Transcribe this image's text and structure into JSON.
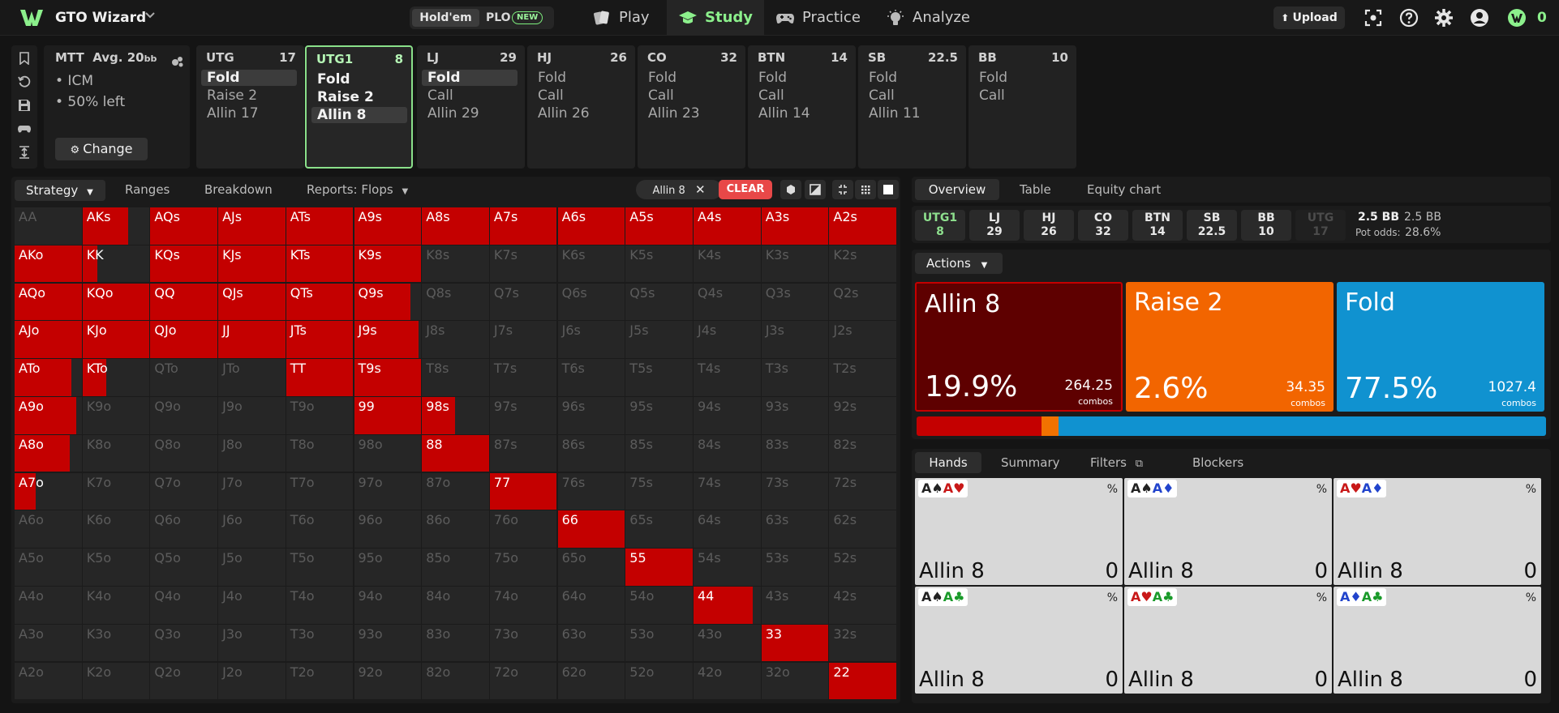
{
  "app": {
    "title": "GTO Wizard"
  },
  "game_switch": {
    "holdem": "Hold'em",
    "plo": "PLO",
    "new_badge": "NEW"
  },
  "nav": {
    "play": "Play",
    "study": "Study",
    "practice": "Practice",
    "analyze": "Analyze"
  },
  "toolbar": {
    "upload": "Upload",
    "balance": "0"
  },
  "mtt": {
    "title": "MTT",
    "avg": "Avg. 20",
    "bb": "bb",
    "line1": "• ICM",
    "line2": "• 50% left",
    "change": "Change"
  },
  "positions": [
    {
      "name": "UTG",
      "stack": "17",
      "actions": [
        "Fold",
        "Raise 2",
        "Allin 17"
      ]
    },
    {
      "name": "UTG1",
      "stack": "8",
      "actions": [
        "Fold",
        "Raise 2",
        "Allin 8"
      ]
    },
    {
      "name": "LJ",
      "stack": "29",
      "actions": [
        "Fold",
        "Call",
        "Allin 29"
      ]
    },
    {
      "name": "HJ",
      "stack": "26",
      "actions": [
        "Fold",
        "Call",
        "Allin 26"
      ]
    },
    {
      "name": "CO",
      "stack": "32",
      "actions": [
        "Fold",
        "Call",
        "Allin 23"
      ]
    },
    {
      "name": "BTN",
      "stack": "14",
      "actions": [
        "Fold",
        "Call",
        "Allin 14"
      ]
    },
    {
      "name": "SB",
      "stack": "22.5",
      "actions": [
        "Fold",
        "Call",
        "Allin 11"
      ]
    },
    {
      "name": "BB",
      "stack": "10",
      "actions": [
        "Fold",
        "Call"
      ]
    }
  ],
  "left_tabs": {
    "strategy": "Strategy",
    "ranges": "Ranges",
    "breakdown": "Breakdown",
    "reports": "Reports: Flops",
    "chip": "Allin 8",
    "clear": "CLEAR"
  },
  "matrix": {
    "ranks": [
      "A",
      "K",
      "Q",
      "J",
      "T",
      "9",
      "8",
      "7",
      "6",
      "5",
      "4",
      "3",
      "2"
    ],
    "fills": [
      [
        0,
        0.68,
        1,
        1,
        1,
        1,
        1,
        1,
        1,
        1,
        1,
        1,
        1
      ],
      [
        1,
        0.22,
        1,
        1,
        1,
        1,
        0,
        0,
        0,
        0,
        0,
        0,
        0
      ],
      [
        1,
        1,
        1,
        1,
        1,
        0.84,
        0,
        0,
        0,
        0,
        0,
        0,
        0
      ],
      [
        1,
        1,
        1,
        1,
        1,
        0.96,
        0,
        0,
        0,
        0,
        0,
        0,
        0
      ],
      [
        0.85,
        0.36,
        0,
        0,
        1,
        1,
        0,
        0,
        0,
        0,
        0,
        0,
        0
      ],
      [
        0.92,
        0,
        0,
        0,
        0,
        1,
        0.5,
        0,
        0,
        0,
        0,
        0,
        0
      ],
      [
        0.82,
        0,
        0,
        0,
        0,
        0,
        1,
        0,
        0,
        0,
        0,
        0,
        0
      ],
      [
        0.32,
        0,
        0,
        0,
        0,
        0,
        0,
        1,
        0,
        0,
        0,
        0,
        0
      ],
      [
        0,
        0,
        0,
        0,
        0,
        0,
        0,
        0,
        1,
        0,
        0,
        0,
        0
      ],
      [
        0,
        0,
        0,
        0,
        0,
        0,
        0,
        0,
        0,
        1,
        0,
        0,
        0
      ],
      [
        0,
        0,
        0,
        0,
        0,
        0,
        0,
        0,
        0,
        0,
        0.88,
        0,
        0
      ],
      [
        0,
        0,
        0,
        0,
        0,
        0,
        0,
        0,
        0,
        0,
        0,
        1,
        0
      ],
      [
        0,
        0,
        0,
        0,
        0,
        0,
        0,
        0,
        0,
        0,
        0,
        0,
        1
      ]
    ]
  },
  "right_tabs": {
    "overview": "Overview",
    "table": "Table",
    "equity": "Equity chart"
  },
  "pos_row": [
    {
      "name": "UTG1",
      "stack": "8",
      "state": "act"
    },
    {
      "name": "LJ",
      "stack": "29",
      "state": "norm"
    },
    {
      "name": "HJ",
      "stack": "26",
      "state": "norm"
    },
    {
      "name": "CO",
      "stack": "32",
      "state": "norm"
    },
    {
      "name": "BTN",
      "stack": "14",
      "state": "norm"
    },
    {
      "name": "SB",
      "stack": "22.5",
      "state": "norm"
    },
    {
      "name": "BB",
      "stack": "10",
      "state": "norm"
    },
    {
      "name": "UTG",
      "stack": "17",
      "state": "dim"
    }
  ],
  "pot": {
    "bb1": "2.5 BB",
    "bb2": "2.5 BB",
    "odds_label": "Pot odds:",
    "odds": "28.6%"
  },
  "actions_label": "Actions",
  "actions": [
    {
      "name": "Allin 8",
      "pct": "19.9%",
      "combos": "264.25",
      "freq": 19.9,
      "color": "#5e0000",
      "bar": "#c40000"
    },
    {
      "name": "Raise 2",
      "pct": "2.6%",
      "combos": "34.35",
      "freq": 2.6,
      "color": "#f26500",
      "bar": "#f27200"
    },
    {
      "name": "Fold",
      "pct": "77.5%",
      "combos": "1027.4",
      "freq": 77.5,
      "color": "#1092d0",
      "bar": "#1092d0"
    }
  ],
  "combos_label": "combos",
  "hand_tabs": {
    "hands": "Hands",
    "summary": "Summary",
    "filters": "Filters",
    "blockers": "Blockers"
  },
  "hand_cards": [
    {
      "c1": "A♠",
      "k1": "blk",
      "c2": "A♥",
      "k2": "red",
      "pct": "%",
      "action": "Allin 8",
      "value": "0"
    },
    {
      "c1": "A♠",
      "k1": "blk",
      "c2": "A♦",
      "k2": "blu",
      "pct": "%",
      "action": "Allin 8",
      "value": "0"
    },
    {
      "c1": "A♥",
      "k1": "red",
      "c2": "A♦",
      "k2": "blu",
      "pct": "%",
      "action": "Allin 8",
      "value": "0"
    },
    {
      "c1": "A♠",
      "k1": "blk",
      "c2": "A♣",
      "k2": "grn",
      "pct": "%",
      "action": "Allin 8",
      "value": "0"
    },
    {
      "c1": "A♥",
      "k1": "red",
      "c2": "A♣",
      "k2": "grn",
      "pct": "%",
      "action": "Allin 8",
      "value": "0"
    },
    {
      "c1": "A♦",
      "k1": "blu",
      "c2": "A♣",
      "k2": "grn",
      "pct": "%",
      "action": "Allin 8",
      "value": "0"
    }
  ]
}
